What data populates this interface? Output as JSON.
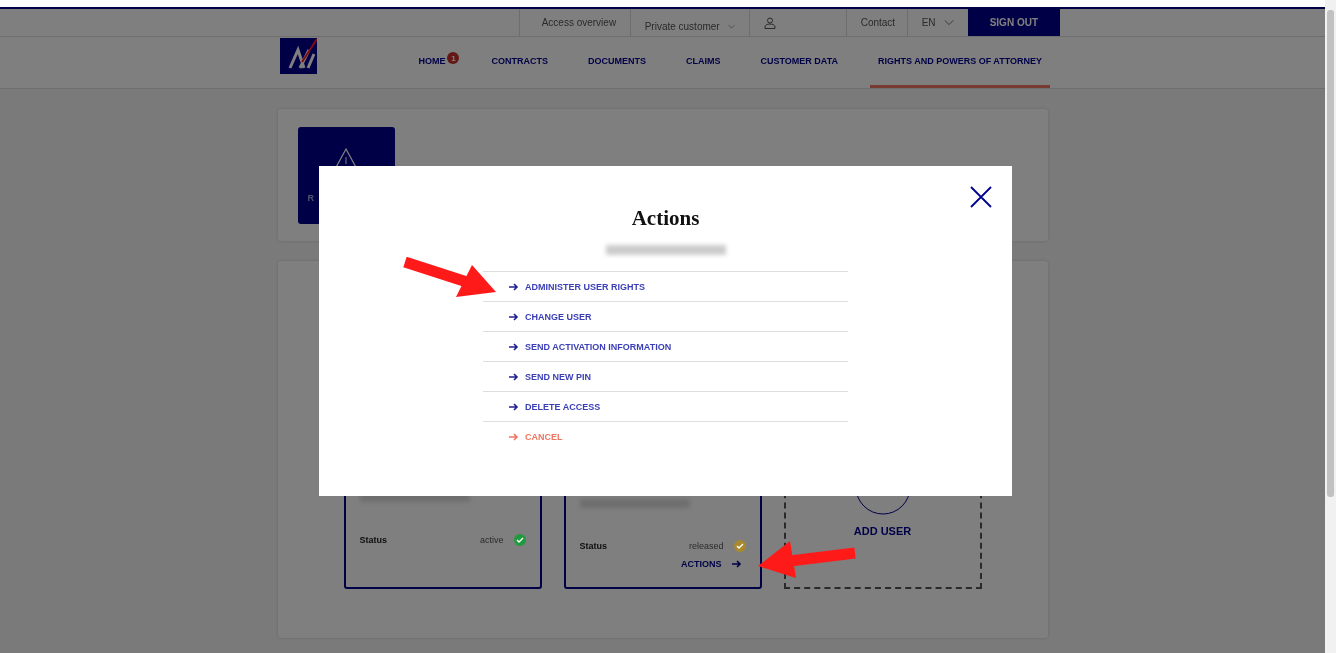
{
  "header": {
    "back_link": "Access overview",
    "customer_select": "Private customer",
    "contact": "Contact",
    "language": "EN",
    "sign_out": "SIGN OUT"
  },
  "nav": [
    {
      "label": "HOME",
      "badge": "1",
      "selected": false
    },
    {
      "label": "CONTRACTS",
      "selected": false
    },
    {
      "label": "DOCUMENTS",
      "selected": false
    },
    {
      "label": "CLAIMS",
      "selected": false
    },
    {
      "label": "CUSTOMER DATA",
      "selected": false
    },
    {
      "label": "RIGHTS AND POWERS OF ATTORNEY",
      "selected": true
    }
  ],
  "tile": {
    "label": "R"
  },
  "users": [
    {
      "status_label": "Status",
      "status": "active",
      "color": "#1f9a3c"
    },
    {
      "status_label": "Status",
      "status": "released",
      "color": "#a8892e",
      "actions": "ACTIONS"
    }
  ],
  "add_user": "ADD USER",
  "modal": {
    "title": "Actions",
    "items": [
      {
        "label": "ADMINISTER USER RIGHTS",
        "kind": "action"
      },
      {
        "label": "CHANGE USER",
        "kind": "action"
      },
      {
        "label": "SEND ACTIVATION INFORMATION",
        "kind": "action"
      },
      {
        "label": "SEND NEW PIN",
        "kind": "action"
      },
      {
        "label": "DELETE ACCESS",
        "kind": "action"
      },
      {
        "label": "CANCEL",
        "kind": "cancel"
      }
    ]
  }
}
